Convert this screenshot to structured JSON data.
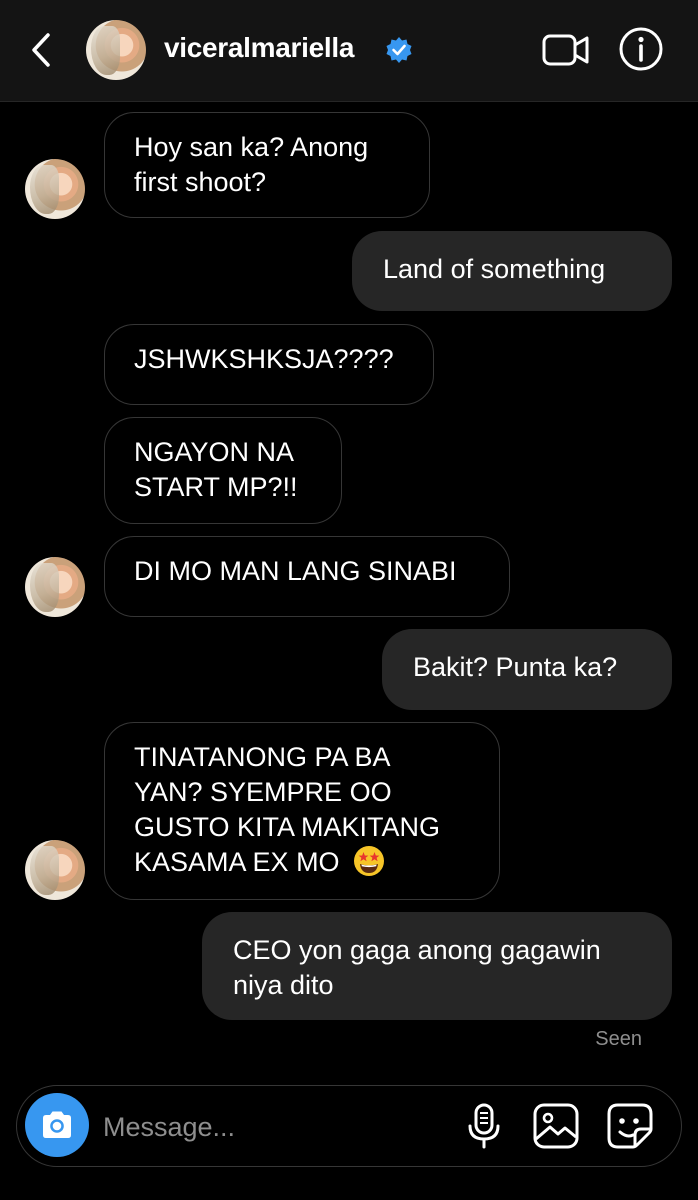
{
  "header": {
    "username": "viceralmariella",
    "verified": true,
    "icons": [
      "back-icon",
      "verified-badge-icon",
      "video-call-icon",
      "info-icon"
    ]
  },
  "messages": [
    {
      "from": "them",
      "lines": [
        "Hoy san ka? Anong",
        "first shoot?"
      ]
    },
    {
      "from": "me",
      "lines": [
        "Land of something"
      ]
    },
    {
      "from": "them",
      "lines": [
        "JSHWKSHKSJA????"
      ]
    },
    {
      "from": "them",
      "lines": [
        "NGAYON NA",
        "START MP?!!"
      ]
    },
    {
      "from": "them",
      "lines": [
        "DI MO MAN LANG SINABI"
      ]
    },
    {
      "from": "me",
      "lines": [
        "Bakit? Punta ka?"
      ]
    },
    {
      "from": "them",
      "lines": [
        "TINATANONG PA BA",
        "YAN? SYEMPRE OO",
        "GUSTO KITA MAKITANG",
        "KASAMA EX MO"
      ],
      "emoji": "star-struck"
    },
    {
      "from": "me",
      "lines": [
        "CEO yon gaga anong gagawin",
        "niya dito"
      ]
    }
  ],
  "status": {
    "seen": "Seen"
  },
  "composer": {
    "placeholder": "Message...",
    "icons": [
      "camera-icon",
      "microphone-icon",
      "gallery-icon",
      "sticker-icon"
    ]
  },
  "colors": {
    "accent": "#3797f0",
    "sent_bubble": "#262626",
    "border": "#363636",
    "muted": "#8e8e8e"
  }
}
